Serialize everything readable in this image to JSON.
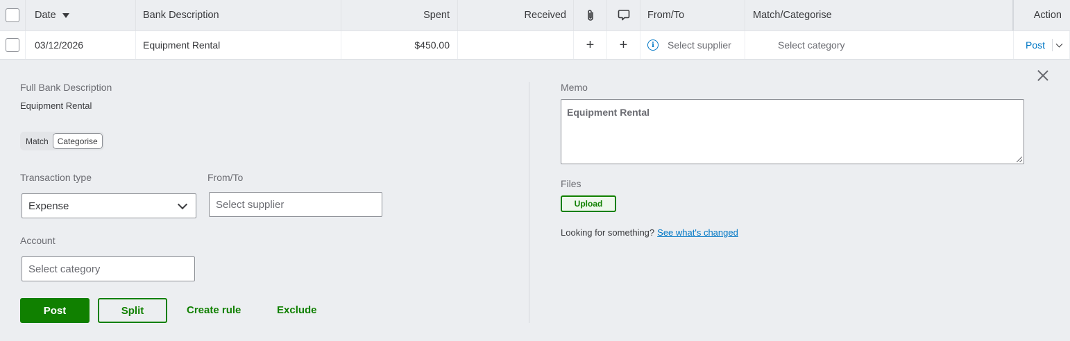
{
  "table": {
    "headers": {
      "date": "Date",
      "bank_description": "Bank Description",
      "spent": "Spent",
      "received": "Received",
      "from_to": "From/To",
      "match_categorise": "Match/Categorise",
      "action": "Action"
    },
    "row": {
      "date": "03/12/2026",
      "description": "Equipment Rental",
      "spent": "$450.00",
      "received": "",
      "attach": "+",
      "comment": "+",
      "from_to_placeholder": "Select supplier",
      "category_placeholder": "Select category",
      "action": "Post"
    }
  },
  "detail": {
    "full_bank_description_label": "Full Bank Description",
    "full_bank_description": "Equipment Rental",
    "toggle": {
      "match": "Match",
      "categorise": "Categorise",
      "active": "categorise"
    },
    "transaction_type_label": "Transaction type",
    "transaction_type_value": "Expense",
    "from_to_label": "From/To",
    "from_to_placeholder": "Select supplier",
    "account_label": "Account",
    "account_placeholder": "Select category",
    "post_button": "Post",
    "split_button": "Split",
    "create_rule_link": "Create rule",
    "exclude_link": "Exclude",
    "memo_label": "Memo",
    "memo_value": "Equipment Rental",
    "files_label": "Files",
    "upload_button": "Upload",
    "looking_text": "Looking for something?",
    "see_changed_link": "See what's changed"
  },
  "colors": {
    "brand_green": "#108000",
    "link_blue": "#0077c5",
    "background": "#eceef1"
  }
}
